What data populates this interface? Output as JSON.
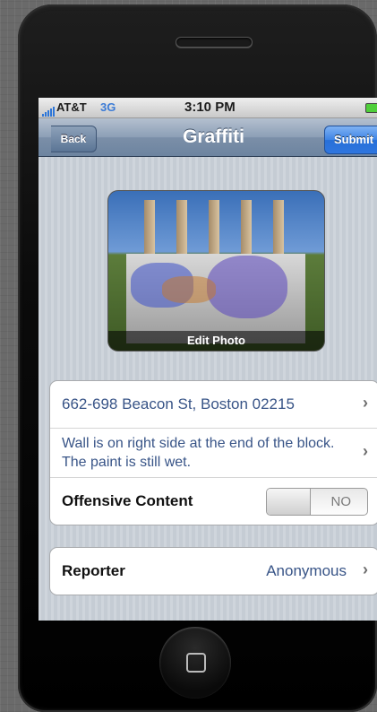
{
  "status_bar": {
    "carrier": "AT&T",
    "network": "3G",
    "time": "3:10 PM"
  },
  "nav": {
    "back_label": "Back",
    "title": "Graffiti",
    "submit_label": "Submit"
  },
  "photo": {
    "caption": "Edit Photo"
  },
  "form": {
    "location": "662-698 Beacon St, Boston 02215",
    "description": "Wall is on right side at the end of the block.  The paint is still wet.",
    "offensive_label": "Offensive Content",
    "offensive_toggle": "NO",
    "reporter_label": "Reporter",
    "reporter_value": "Anonymous"
  },
  "icons": {
    "chevron": "›"
  },
  "colors": {
    "accent": "#3d83e5",
    "value_text": "#385487"
  }
}
